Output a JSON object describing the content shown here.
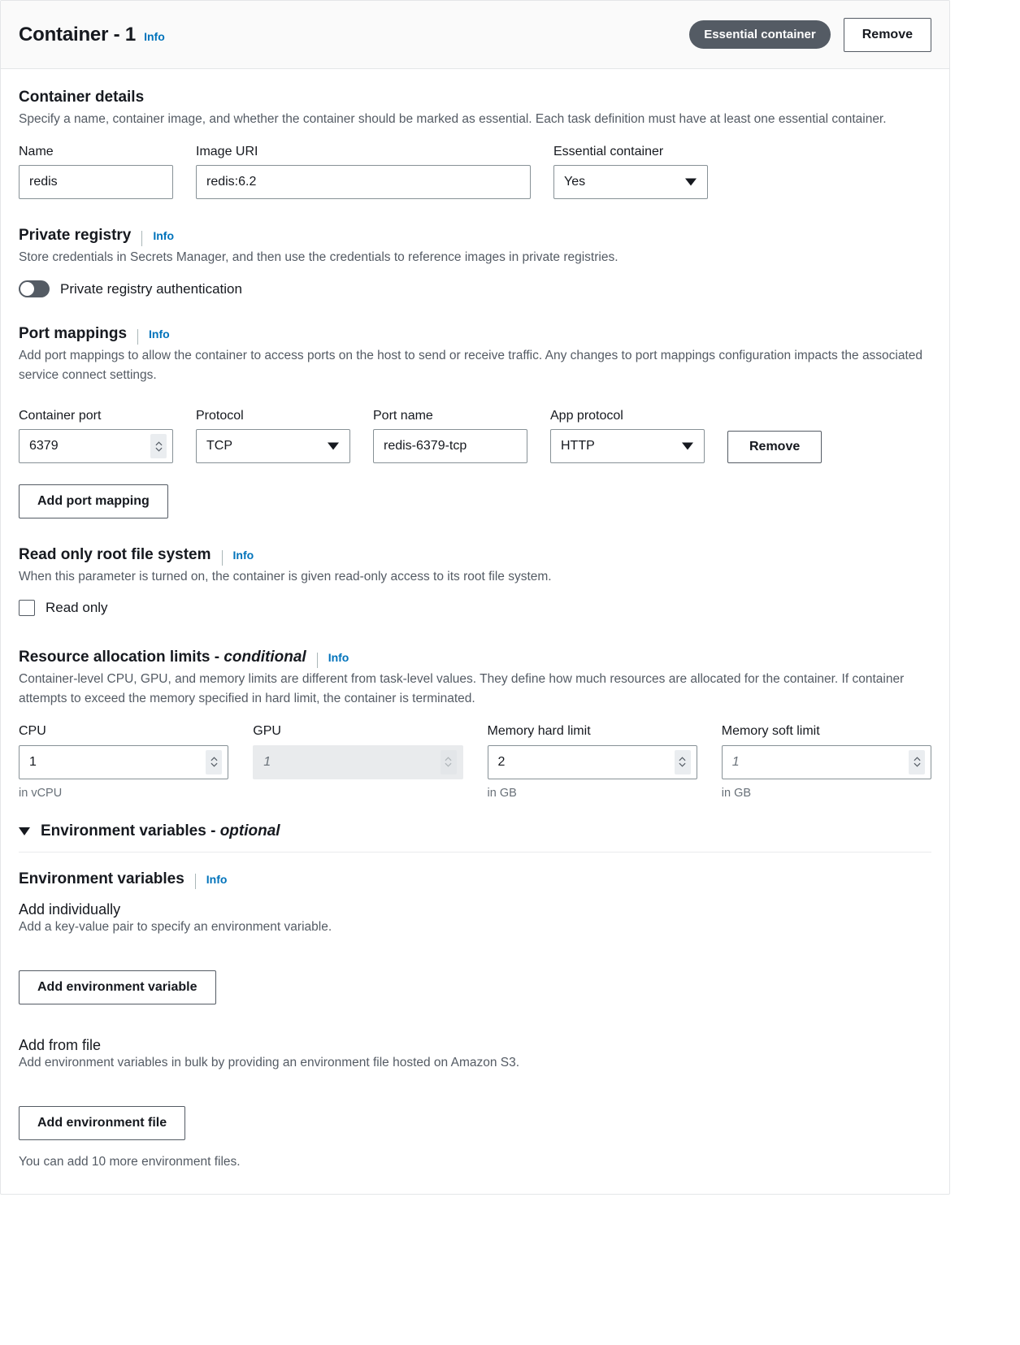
{
  "header": {
    "title": "Container - 1",
    "info_label": "Info",
    "essential_badge": "Essential container",
    "remove_label": "Remove"
  },
  "container_details": {
    "title": "Container details",
    "description": "Specify a name, container image, and whether the container should be marked as essential. Each task definition must have at least one essential container.",
    "name": {
      "label": "Name",
      "value": "redis"
    },
    "image_uri": {
      "label": "Image URI",
      "value": "redis:6.2"
    },
    "essential": {
      "label": "Essential container",
      "value": "Yes"
    }
  },
  "private_registry": {
    "title": "Private registry",
    "info_label": "Info",
    "description": "Store credentials in Secrets Manager, and then use the credentials to reference images in private registries.",
    "toggle_label": "Private registry authentication",
    "toggle_state": "off"
  },
  "port_mappings": {
    "title": "Port mappings",
    "info_label": "Info",
    "description": "Add port mappings to allow the container to access ports on the host to send or receive traffic. Any changes to port mappings configuration impacts the associated service connect settings.",
    "columns": {
      "container_port": "Container port",
      "protocol": "Protocol",
      "port_name": "Port name",
      "app_protocol": "App protocol"
    },
    "row": {
      "container_port": "6379",
      "protocol": "TCP",
      "port_name": "redis-6379-tcp",
      "app_protocol": "HTTP",
      "remove_label": "Remove"
    },
    "add_label": "Add port mapping"
  },
  "read_only_root": {
    "title": "Read only root file system",
    "info_label": "Info",
    "description": "When this parameter is turned on, the container is given read-only access to its root file system.",
    "checkbox_label": "Read only",
    "checked": false
  },
  "resource_limits": {
    "title_main": "Resource allocation limits",
    "title_sep": " - ",
    "title_italic": "conditional",
    "info_label": "Info",
    "description": "Container-level CPU, GPU, and memory limits are different from task-level values. They define how much resources are allocated for the container. If container attempts to exceed the memory specified in hard limit, the container is terminated.",
    "cpu": {
      "label": "CPU",
      "value": "1",
      "placeholder": "",
      "hint": "in vCPU",
      "disabled": false
    },
    "gpu": {
      "label": "GPU",
      "value": "",
      "placeholder": "1",
      "hint": "",
      "disabled": true
    },
    "memory_hard": {
      "label": "Memory hard limit",
      "value": "2",
      "placeholder": "",
      "hint": "in GB",
      "disabled": false
    },
    "memory_soft": {
      "label": "Memory soft limit",
      "value": "",
      "placeholder": "1",
      "hint": "in GB",
      "disabled": false
    }
  },
  "environment": {
    "section_title_main": "Environment variables",
    "section_title_sep": " - ",
    "section_title_italic": "optional",
    "sub_title": "Environment variables",
    "info_label": "Info",
    "add_individually": {
      "heading": "Add individually",
      "description": "Add a key-value pair to specify an environment variable.",
      "button_label": "Add environment variable"
    },
    "add_from_file": {
      "heading": "Add from file",
      "description": "Add environment variables in bulk by providing an environment file hosted on Amazon S3.",
      "button_label": "Add environment file",
      "footnote": "You can add 10 more environment files."
    }
  }
}
